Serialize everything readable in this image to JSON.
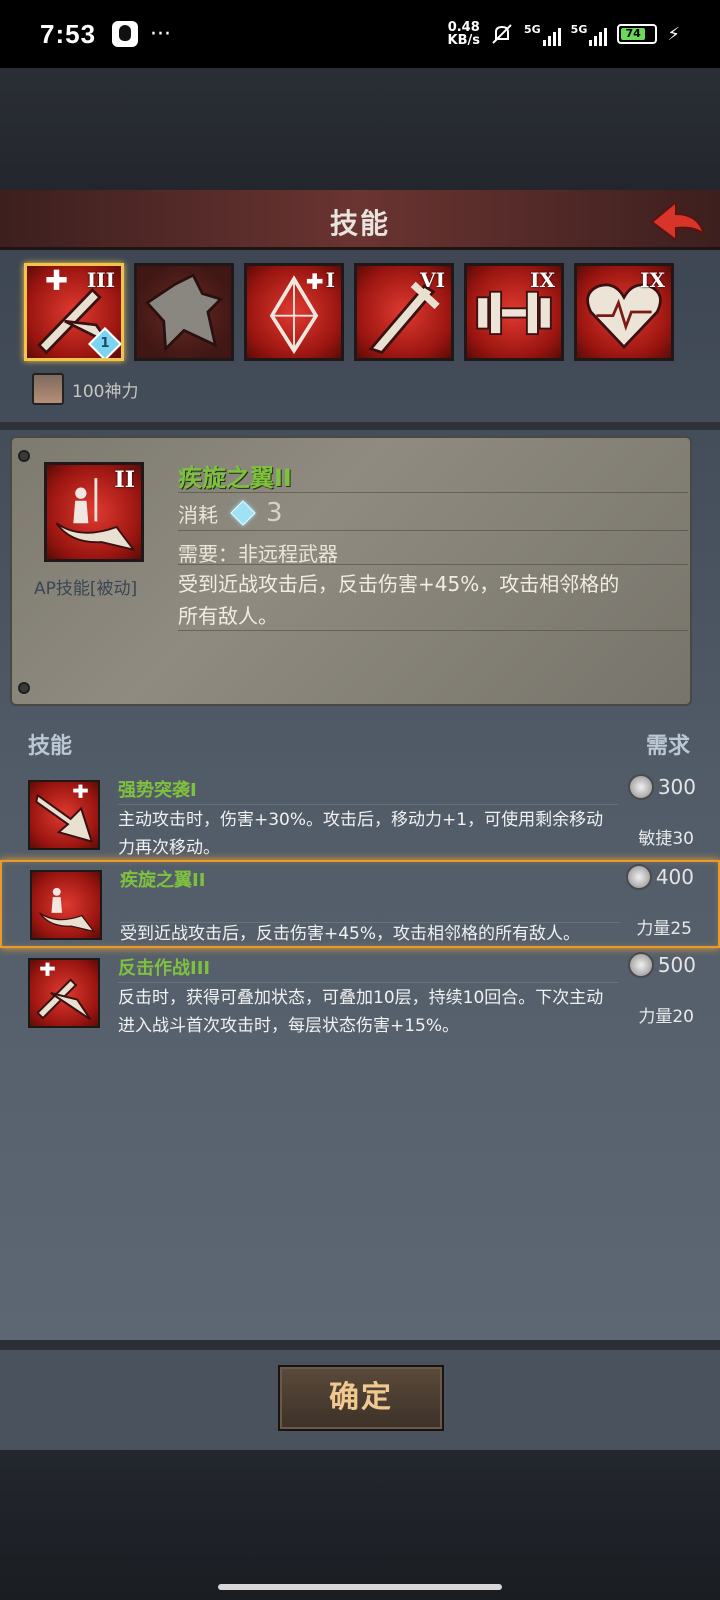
{
  "status_bar": {
    "time": "7:53",
    "net_speed_value": "0.48",
    "net_speed_unit": "KB/s",
    "signal1": "5G",
    "signal2": "5G",
    "battery": "74"
  },
  "header": {
    "title": "技能"
  },
  "skill_icons": [
    {
      "roman": "III",
      "level": "1",
      "selected": true
    },
    {
      "roman": "",
      "selected": false
    },
    {
      "roman": "I",
      "selected": false
    },
    {
      "roman": "VI",
      "selected": false
    },
    {
      "roman": "IX",
      "selected": false
    },
    {
      "roman": "IX",
      "selected": false
    }
  ],
  "divine_power": "100神力",
  "detail": {
    "roman": "II",
    "type": "AP技能[被动]",
    "name": "疾旋之翼II",
    "cost_label": "消耗",
    "cost_value": "3",
    "requirement": "需要：非远程武器",
    "description": "受到近战攻击后，反击伤害+45%，攻击相邻格的所有敌人。"
  },
  "list": {
    "header_left": "技能",
    "header_right": "需求",
    "rows": [
      {
        "name": "强势突袭I",
        "description": "主动攻击时，伤害+30%。攻击后，移动力+1，可使用剩余移动力再次移动。",
        "price": "300",
        "requirement": "敏捷30"
      },
      {
        "name": "疾旋之翼II",
        "description": "受到近战攻击后，反击伤害+45%，攻击相邻格的所有敌人。",
        "price": "400",
        "requirement": "力量25"
      },
      {
        "name": "反击作战III",
        "description": "反击时，获得可叠加状态，可叠加10层，持续10回合。下次主动进入战斗首次攻击时，每层状态伤害+15%。",
        "price": "500",
        "requirement": "力量20"
      }
    ]
  },
  "confirm_label": "确定"
}
